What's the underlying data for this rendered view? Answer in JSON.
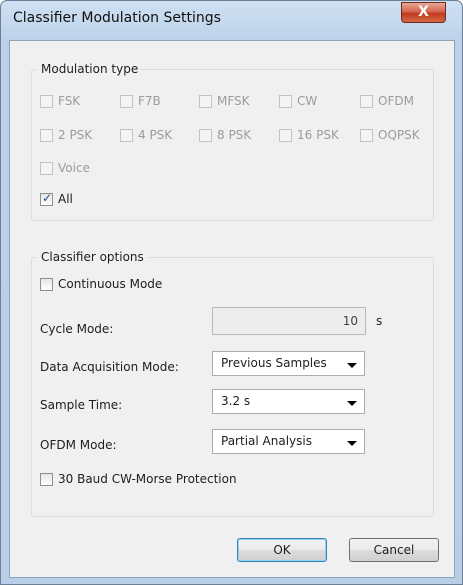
{
  "window": {
    "title": "Classifier Modulation Settings",
    "close_glyph": "X"
  },
  "modulation_group": {
    "label": "Modulation type",
    "items": [
      {
        "label": "FSK",
        "checked": false,
        "enabled": false
      },
      {
        "label": "F7B",
        "checked": false,
        "enabled": false
      },
      {
        "label": "MFSK",
        "checked": false,
        "enabled": false
      },
      {
        "label": "CW",
        "checked": false,
        "enabled": false
      },
      {
        "label": "OFDM",
        "checked": false,
        "enabled": false
      },
      {
        "label": "2 PSK",
        "checked": false,
        "enabled": false
      },
      {
        "label": "4 PSK",
        "checked": false,
        "enabled": false
      },
      {
        "label": "8 PSK",
        "checked": false,
        "enabled": false
      },
      {
        "label": "16 PSK",
        "checked": false,
        "enabled": false
      },
      {
        "label": "OQPSK",
        "checked": false,
        "enabled": false
      },
      {
        "label": "Voice",
        "checked": false,
        "enabled": false
      },
      {
        "label": "All",
        "checked": true,
        "enabled": true
      }
    ]
  },
  "classifier_group": {
    "label": "Classifier options",
    "continuous_mode": {
      "label": "Continuous Mode",
      "checked": false
    },
    "cycle_mode": {
      "label": "Cycle Mode:",
      "value": "10",
      "unit": "s"
    },
    "data_acquisition": {
      "label": "Data Acquisition Mode:",
      "value": "Previous Samples"
    },
    "sample_time": {
      "label": "Sample Time:",
      "value": "3.2 s"
    },
    "ofdm_mode": {
      "label": "OFDM Mode:",
      "value": "Partial Analysis"
    },
    "cw_protection": {
      "label": "30 Baud CW-Morse Protection",
      "checked": false
    }
  },
  "buttons": {
    "ok": "OK",
    "cancel": "Cancel"
  },
  "colors": {
    "accent": "#3c7fb1",
    "frame": "#bcd2ea",
    "close": "#c03a1f"
  }
}
